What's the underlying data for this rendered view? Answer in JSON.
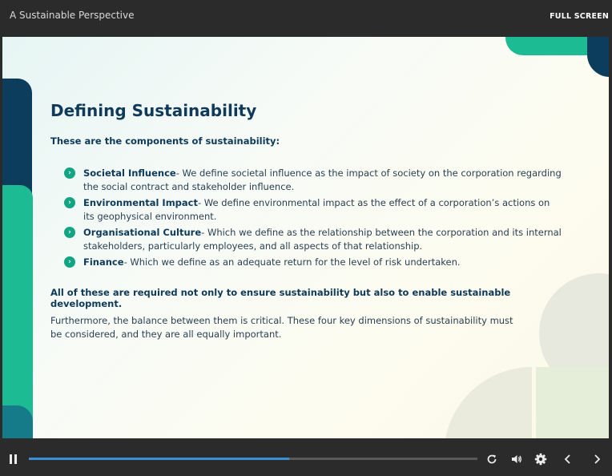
{
  "header": {
    "course_title": "A Sustainable Perspective",
    "fullscreen_label": "FULL SCREEN"
  },
  "slide": {
    "title": "Defining Sustainability",
    "subtitle": "These are the components of sustainability:",
    "items": [
      {
        "term": "Societal Influence",
        "text": "- We define societal influence as the impact of society on the corporation regarding the social contract and stakeholder influence."
      },
      {
        "term": "Environmental Impact",
        "text": "- We define environmental impact as the effect of a corporation’s actions on its geophysical environment."
      },
      {
        "term": "Organisational Culture",
        "text": "- Which we define as the relationship between the corporation and its internal stakeholders, particularly employees, and all aspects of that relationship."
      },
      {
        "term": "Finance",
        "text": "- Which we define as an adequate return for the level of risk undertaken."
      }
    ],
    "conclusion": "All of these are required not only to ensure sustainability but also to enable sustainable development.",
    "paragraph": "Furthermore, the balance between them is critical. These four key dimensions of sustainability must be considered, and they are all equally important."
  },
  "player": {
    "progress_percent": 58,
    "icons": [
      "pause-icon",
      "replay-icon",
      "volume-icon",
      "settings-icon",
      "chevron-left-icon",
      "chevron-right-icon"
    ]
  },
  "colors": {
    "accent_green": "#1dbb93",
    "navy": "#0d3d5c",
    "progress_blue": "#3a8fd6"
  }
}
